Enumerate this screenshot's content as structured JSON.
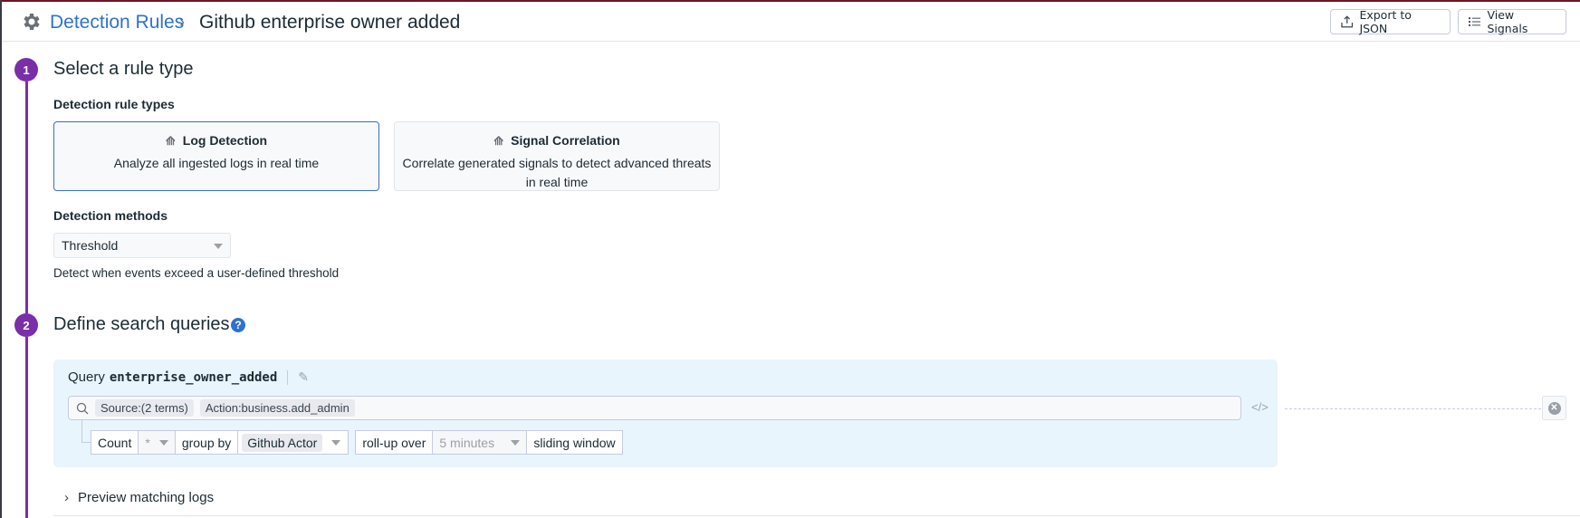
{
  "header": {
    "breadcrumb_link": "Detection Rules",
    "separator": "›",
    "current": "Github enterprise owner added",
    "export_label": "Export to JSON",
    "view_signals_label": "View Signals"
  },
  "step1": {
    "number": "1",
    "title": "Select a rule type",
    "rule_types_label": "Detection rule types",
    "cards": [
      {
        "title": "Log Detection",
        "desc": "Analyze all ingested logs in real time",
        "selected": true
      },
      {
        "title": "Signal Correlation",
        "desc": "Correlate generated signals to detect advanced threats in real time",
        "selected": false
      }
    ],
    "methods_label": "Detection methods",
    "method_value": "Threshold",
    "method_desc": "Detect when events exceed a user-defined threshold"
  },
  "step2": {
    "number": "2",
    "title": "Define search queries",
    "query": {
      "prefix": "Query",
      "name": "enterprise_owner_added",
      "terms": [
        "Source:(2 terms)",
        "Action:business.add_admin"
      ],
      "aggregation": "Count",
      "field": "*",
      "group_by_label": "group by",
      "group_by_value": "Github Actor",
      "rollup_label": "roll-up over",
      "rollup_value": "5 minutes",
      "window": "sliding window"
    },
    "preview_label": "Preview matching logs"
  },
  "colors": {
    "accent": "#7a2ea8",
    "link": "#2f71cf",
    "query_bg": "#e9f5fc"
  }
}
